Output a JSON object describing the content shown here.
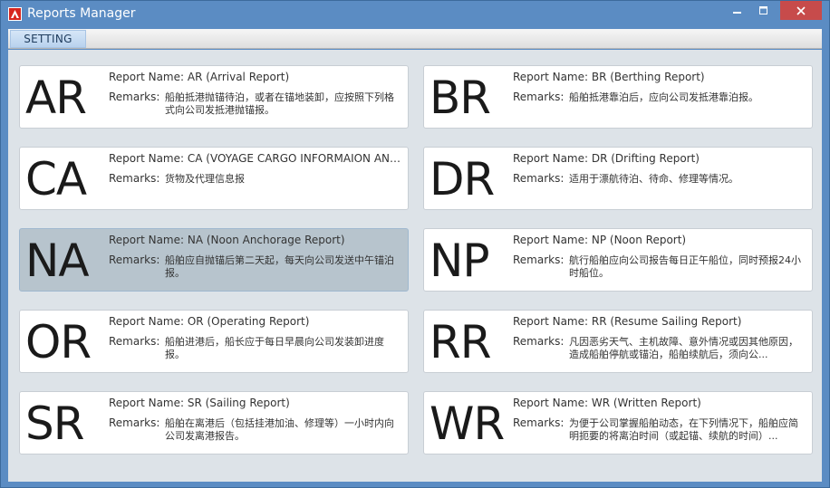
{
  "window": {
    "title": "Reports Manager",
    "accent_color": "#5b8cc3",
    "close_color": "#c74b4b"
  },
  "menu": {
    "setting_label": "SETTING"
  },
  "labels": {
    "report_name_prefix": "Report Name: ",
    "remarks_label": "Remarks:"
  },
  "reports": [
    {
      "code": "AR",
      "name": "AR (Arrival Report)",
      "remarks": "船舶抵港抛锚待泊，或者在锚地装卸，应按照下列格式向公司发抵港抛锚报。",
      "selected": false
    },
    {
      "code": "BR",
      "name": "BR (Berthing Report)",
      "remarks": "船舶抵港靠泊后，应向公司发抵港靠泊报。",
      "selected": false
    },
    {
      "code": "CA",
      "name": "CA (VOYAGE CARGO INFORMAION AND ...",
      "remarks": "货物及代理信息报",
      "selected": false
    },
    {
      "code": "DR",
      "name": "DR (Drifting Report)",
      "remarks": "适用于漂航待泊、待命、修理等情况。",
      "selected": false
    },
    {
      "code": "NA",
      "name": "NA (Noon Anchorage Report)",
      "remarks": "船舶应自抛锚后第二天起，每天向公司发送中午锚泊报。",
      "selected": true
    },
    {
      "code": "NP",
      "name": "NP (Noon Report)",
      "remarks": "航行船舶应向公司报告每日正午船位，同时预报24小时船位。",
      "selected": false
    },
    {
      "code": "OR",
      "name": "OR (Operating Report)",
      "remarks": "船舶进港后，船长应于每日早晨向公司发装卸进度报。",
      "selected": false
    },
    {
      "code": "RR",
      "name": "RR (Resume Sailing Report)",
      "remarks": "凡因恶劣天气、主机故障、意外情况或因其他原因，造成船舶停航或锚泊，船舶续航后，须向公...",
      "selected": false
    },
    {
      "code": "SR",
      "name": "SR (Sailing Report)",
      "remarks": "船舶在离港后（包括挂港加油、修理等）一小时内向公司发离港报告。",
      "selected": false
    },
    {
      "code": "WR",
      "name": "WR (Written Report)",
      "remarks": "为便于公司掌握船舶动态，在下列情况下，船舶应简明扼要的将离泊时间（或起锚、续航的时间）...",
      "selected": false
    }
  ]
}
